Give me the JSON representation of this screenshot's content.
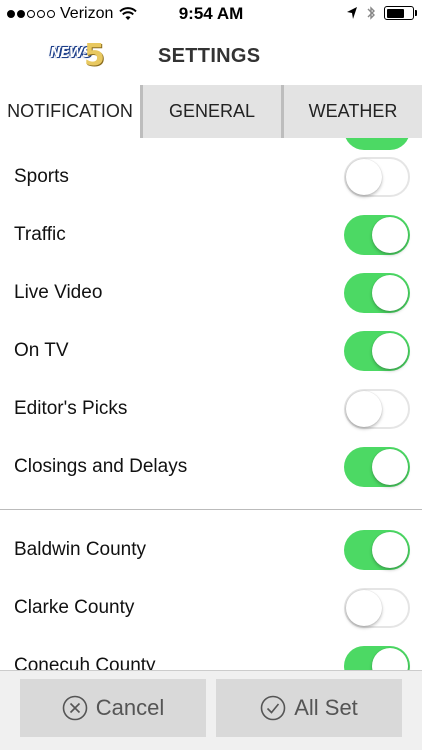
{
  "status_bar": {
    "carrier": "Verizon",
    "time": "9:54 AM",
    "battery_level": 0.7
  },
  "header": {
    "logo_text": "NEWS",
    "logo_number": "5",
    "title": "SETTINGS"
  },
  "tabs": [
    {
      "label": "NOTIFICATION",
      "selected": true
    },
    {
      "label": "GENERAL",
      "selected": false
    },
    {
      "label": "WEATHER",
      "selected": false
    }
  ],
  "notification_items": [
    {
      "label": "Sports",
      "on": false
    },
    {
      "label": "Traffic",
      "on": true
    },
    {
      "label": "Live Video",
      "on": true
    },
    {
      "label": "On TV",
      "on": true
    },
    {
      "label": "Editor's Picks",
      "on": false
    },
    {
      "label": "Closings and Delays",
      "on": true
    }
  ],
  "county_items": [
    {
      "label": "Baldwin County",
      "on": true
    },
    {
      "label": "Clarke County",
      "on": false
    },
    {
      "label": "Conecuh County",
      "on": true
    }
  ],
  "footer": {
    "cancel_label": "Cancel",
    "allset_label": "All Set"
  },
  "colors": {
    "toggle_on": "#4cd964",
    "tab_bg": "#e3e3e3",
    "button_bg": "#d9d9d9"
  }
}
